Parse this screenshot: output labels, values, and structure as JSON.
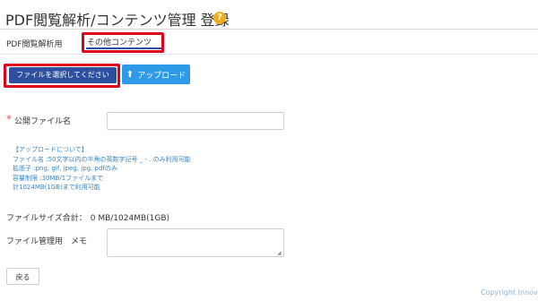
{
  "header": {
    "title": "PDF閲覧解析/コンテンツ管理 登録",
    "help_icon": "?"
  },
  "tabs": [
    {
      "label": "PDF閲覧解析用",
      "active": false
    },
    {
      "label": "その他コンテンツ",
      "active": true
    }
  ],
  "actions": {
    "select_file_label": "ファイルを選択してください",
    "upload_label": "アップロード",
    "upload_icon": "upload-icon"
  },
  "form": {
    "required_mark": "*",
    "public_file_name_label": "公開ファイル名",
    "public_file_name_value": "",
    "upload_info": [
      "【アップロードについて】",
      "ファイル名 :50文字以内の半角の英数字記号 _ - . のみ利用可能",
      "拡張子 :png, gif, jpeg, jpg, pdfのみ",
      "容量制限 :30MB/1ファイルまで",
      "計1024MB(1GB)まで利用可能"
    ],
    "total_size_label": "ファイルサイズ合計：",
    "total_size_value": "0 MB/1024MB(1GB)",
    "memo_label": "ファイル管理用　メモ",
    "memo_value": ""
  },
  "footer": {
    "back_label": "戻る",
    "copyright": "Copyright Innov"
  },
  "colors": {
    "primary": "#2d4f9f",
    "upload": "#2f9ae8",
    "highlight": "#e0001b",
    "info_text": "#3a86c8",
    "required": "#d9534f"
  }
}
